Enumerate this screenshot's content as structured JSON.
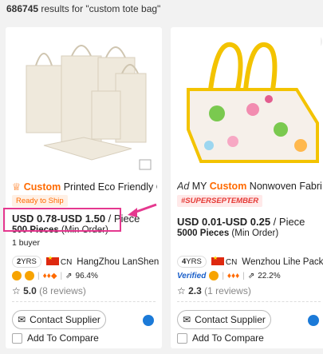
{
  "search": {
    "count": "686745",
    "suffix": " results for \"custom tote bag\""
  },
  "left": {
    "title_prefix": "♕",
    "title_kw": "Custom",
    "title_rest": " Printed Eco Friendly Cotton...",
    "tag": "Ready to Ship",
    "price": "USD 0.78-USD 1.50",
    "price_unit": " / Piece",
    "moq_bold": "500 Pieces",
    "moq_rest": " (Min Order)",
    "buyers": "1 buyer",
    "years_num": "2",
    "years_label": "YRS",
    "country": "CN",
    "supplier": "HangZhou LanSheng I...",
    "response": "96.4%",
    "rating": "5.0",
    "reviews": "(8 reviews)",
    "contact": "Contact Supplier",
    "compare": "Add To Compare"
  },
  "right": {
    "ad": "Ad",
    "title_pre": " MY ",
    "title_kw": "Custom",
    "title_rest": " Nonwoven Fabric...",
    "tag": "#SUPERSEPTEMBER",
    "price": "USD 0.01-USD 0.25",
    "price_unit": " / Piece",
    "moq_bold": "5000 Pieces",
    "moq_rest": " (Min Order)",
    "years_num": "4",
    "years_label": "YRS",
    "country": "CN",
    "supplier": "Wenzhou Lihe Packagi...",
    "verified": "Verified",
    "response": "22.2%",
    "rating": "2.3",
    "reviews": "(1 reviews)",
    "contact": "Contact Supplier",
    "compare": "Add To Compare"
  },
  "colors": {
    "accent": "#ff6a00",
    "callout": "#e5388f",
    "chat": "#1b7ad8"
  }
}
